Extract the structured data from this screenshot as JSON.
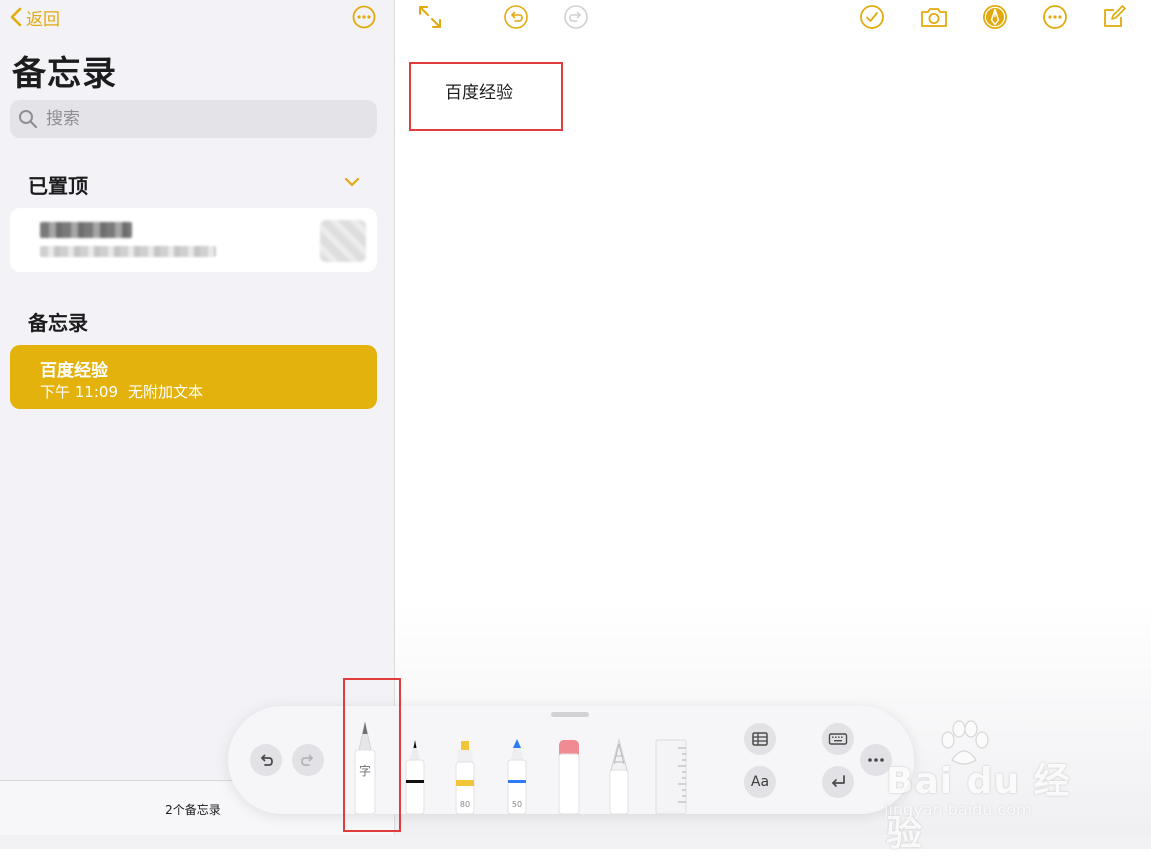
{
  "sidebar": {
    "back_label": "返回",
    "title": "备忘录",
    "search_placeholder": "搜索",
    "pinned_section": "已置顶",
    "notes_section": "备忘录",
    "notes": [
      {
        "title": "百度经验",
        "time": "下午 11:09",
        "preview": "无附加文本",
        "selected": true
      }
    ],
    "note_count": "2个备忘录"
  },
  "toolbar": {
    "icons": [
      "expand-icon",
      "undo-icon",
      "redo-icon",
      "checklist-icon",
      "camera-icon",
      "markup-icon",
      "more-icon",
      "compose-icon"
    ]
  },
  "note": {
    "text": "百度经验"
  },
  "markup_palette": {
    "handwriting_tool_label": "字",
    "highlighter_size": "80",
    "pen_size": "50",
    "text_style_label": "Aa"
  },
  "watermark": {
    "brand": "Bai du 经验",
    "url": "jingyan.baidu.com"
  },
  "colors": {
    "accent": "#e2aa0e",
    "selected_note": "#e3b20d",
    "highlight_box": "#e03c3c",
    "sidebar_bg": "#f2f2f7"
  }
}
